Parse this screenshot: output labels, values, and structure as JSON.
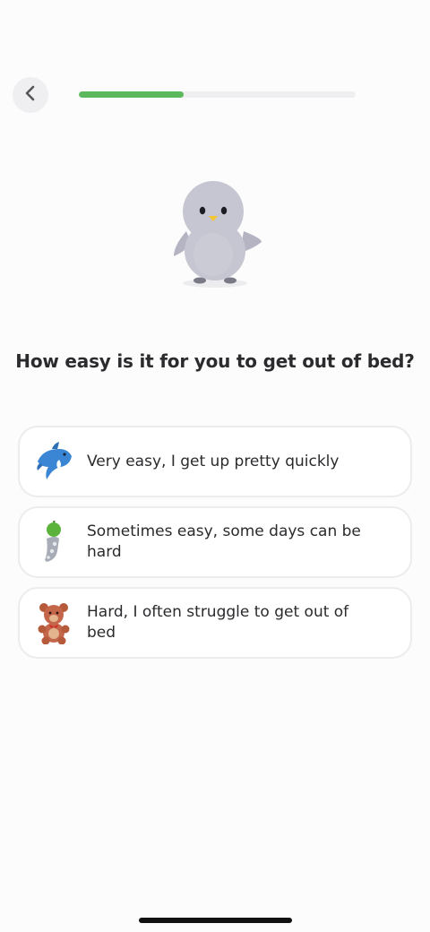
{
  "header": {
    "back_icon": "chevron-left-icon",
    "progress": 0.38,
    "progress_color": "#5cb85c"
  },
  "mascot": {
    "icon": "penguin-mascot-icon"
  },
  "question": "How easy is it for you to get out of bed?",
  "options": [
    {
      "label": "Very easy, I get up pretty quickly",
      "icon": "dolphin-icon"
    },
    {
      "label": "Sometimes easy, some days can be hard",
      "icon": "snail-icon"
    },
    {
      "label": "Hard, I often struggle to get out of bed",
      "icon": "teddy-bear-icon"
    }
  ]
}
